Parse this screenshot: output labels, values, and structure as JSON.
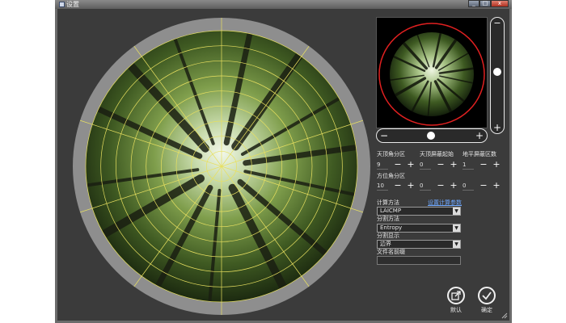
{
  "window": {
    "title": "设置"
  },
  "labels": {
    "zenith_div": "天顶角分区",
    "zenith_mask_start": "天顶屏蔽起始",
    "zenith_mask_end": "地平屏蔽区数",
    "azimuth_div": "方位角分区",
    "calc_method": "计算方法",
    "calc_param": "设置计算参数",
    "classify_method": "分割方法",
    "classify_display": "分割显示",
    "file_prefix": "文件名前缀"
  },
  "steppers": {
    "zenith_div": "9",
    "zenith_mask_start": "0",
    "zenith_mask_end": "1",
    "azimuth_div": "10",
    "azimuth_mask_start": "0",
    "azimuth_mask_end": "0"
  },
  "combos": {
    "calc_method": "LAICMP",
    "classify_method": "Entropy",
    "classify_display": "边界"
  },
  "file_prefix_value": "",
  "buttons": {
    "default": "默认",
    "ok": "确定"
  },
  "symbols": {
    "minus": "−",
    "plus": "+",
    "arrow": "▼"
  },
  "icons": {
    "app": "window-icon",
    "default": "export-icon",
    "ok": "checkmark-icon",
    "grip": "resize-grip-icon"
  },
  "colors": {
    "panel": "#3b3b3b",
    "ring": "#8e8e8e",
    "grid": "#e8e060",
    "preview_circle": "#e02020",
    "link": "#6fa8ff"
  }
}
